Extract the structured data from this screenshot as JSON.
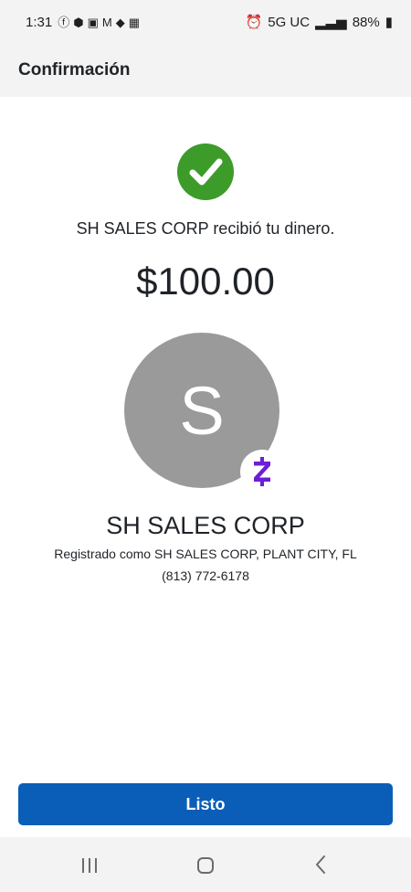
{
  "status_bar": {
    "time": "1:31",
    "network": "5G UC",
    "battery": "88%",
    "icons": [
      "facebook-icon",
      "chase-icon",
      "clipboard-icon",
      "gmail-icon",
      "bag-icon",
      "gallery-icon",
      "alarm-icon",
      "signal-icon",
      "battery-icon"
    ]
  },
  "header": {
    "title": "Confirmación"
  },
  "confirmation": {
    "icon": "checkmark-icon",
    "message": "SH SALES CORP recibió tu dinero.",
    "amount": "$100.00"
  },
  "recipient": {
    "avatar_initial": "S",
    "badge_icon": "zelle-icon",
    "name": "SH SALES CORP",
    "registered_as": "Registrado como SH SALES CORP, PLANT CITY, FL",
    "phone": "(813) 772-6178"
  },
  "actions": {
    "done_label": "Listo"
  },
  "nav_bar": {
    "icons": [
      "recents-icon",
      "home-icon",
      "back-icon"
    ]
  },
  "colors": {
    "success": "#3d9b2a",
    "primary_button": "#0a5eb8",
    "avatar_bg": "#9a9a9a",
    "zelle_purple": "#6d1ed4",
    "bar_bg": "#f3f3f4"
  }
}
